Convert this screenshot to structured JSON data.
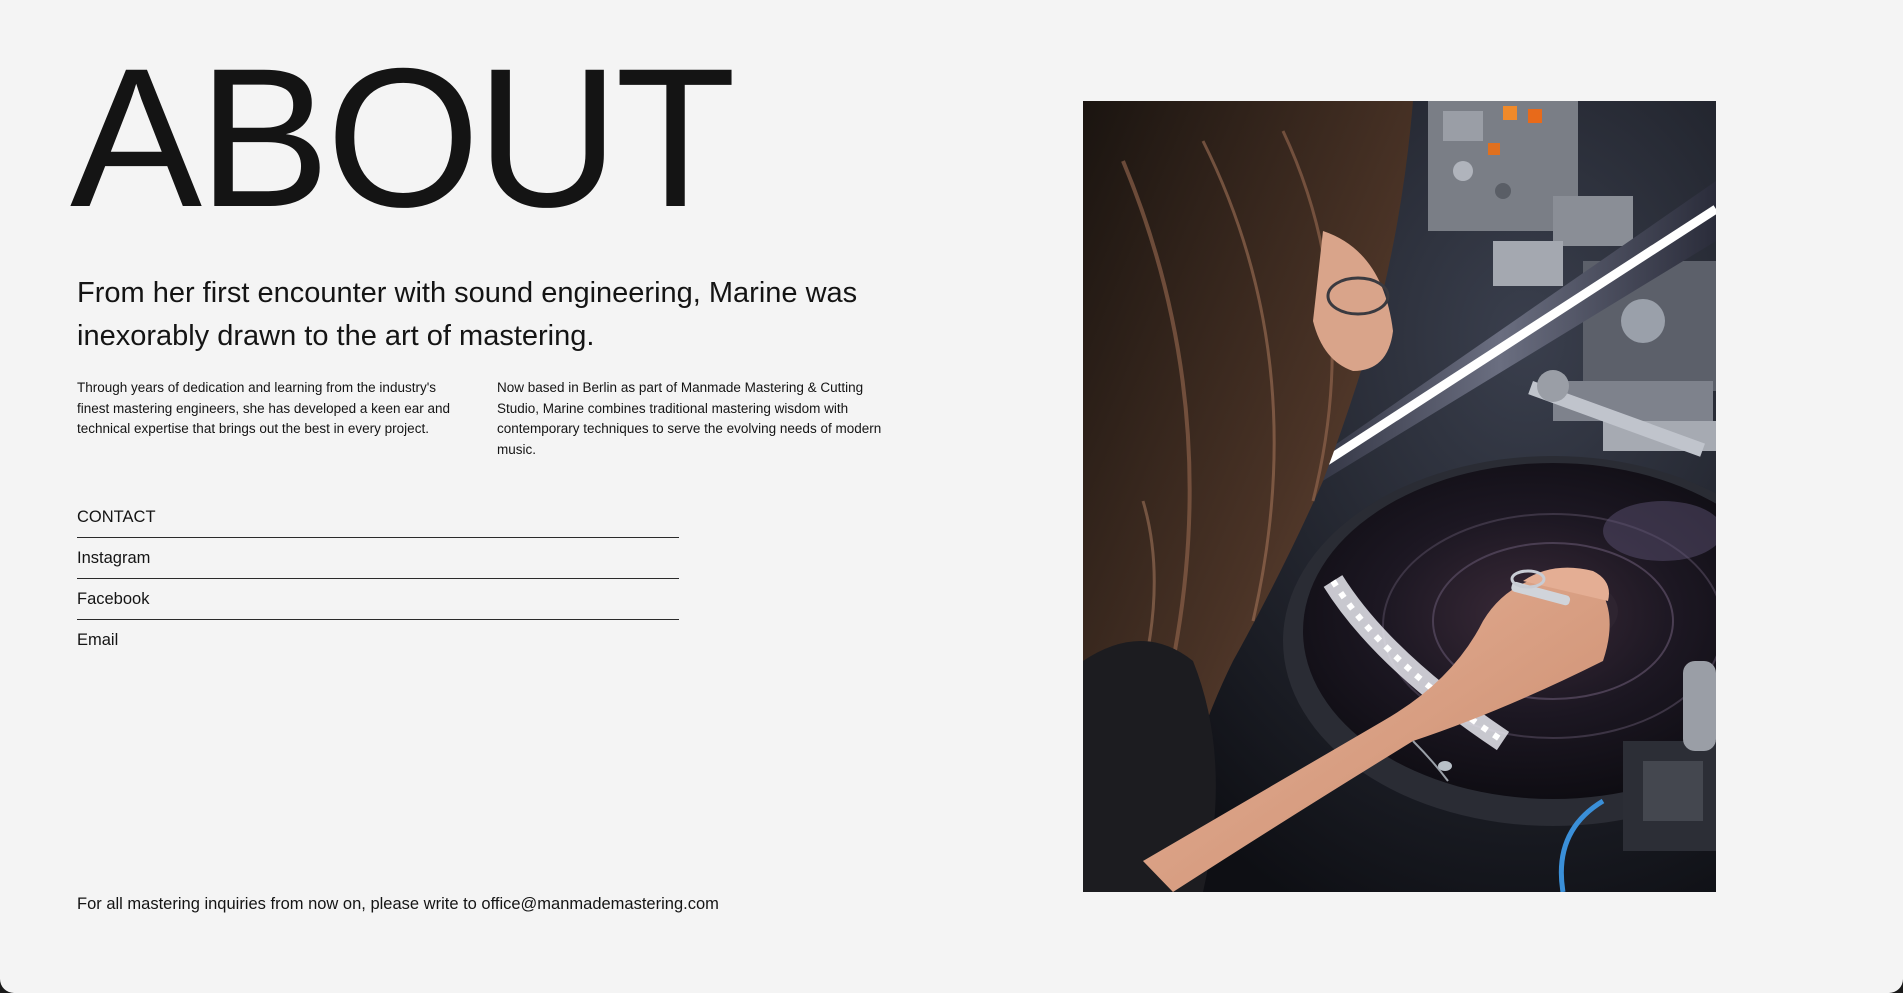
{
  "page": {
    "title": "ABOUT",
    "lead": "From her first encounter with sound engineering, Marine was inexorably drawn to the art of mastering.",
    "body_left": "Through years of dedication and learning from the industry's finest mastering engineers, she has developed a keen ear and technical expertise that brings out the best in every project.",
    "body_right": "Now based in Berlin as part of Manmade Mastering & Cutting Studio, Marine combines traditional mastering wisdom with contemporary techniques to serve the evolving needs of modern music."
  },
  "links": {
    "contact": "CONTACT",
    "instagram": "Instagram",
    "facebook": "Facebook",
    "email": "Email"
  },
  "footer": {
    "note": "For all mastering inquiries from now on, please write to office@manmademastering.com"
  },
  "photo": {
    "subject": "woman-cutting-vinyl-on-lathe"
  }
}
